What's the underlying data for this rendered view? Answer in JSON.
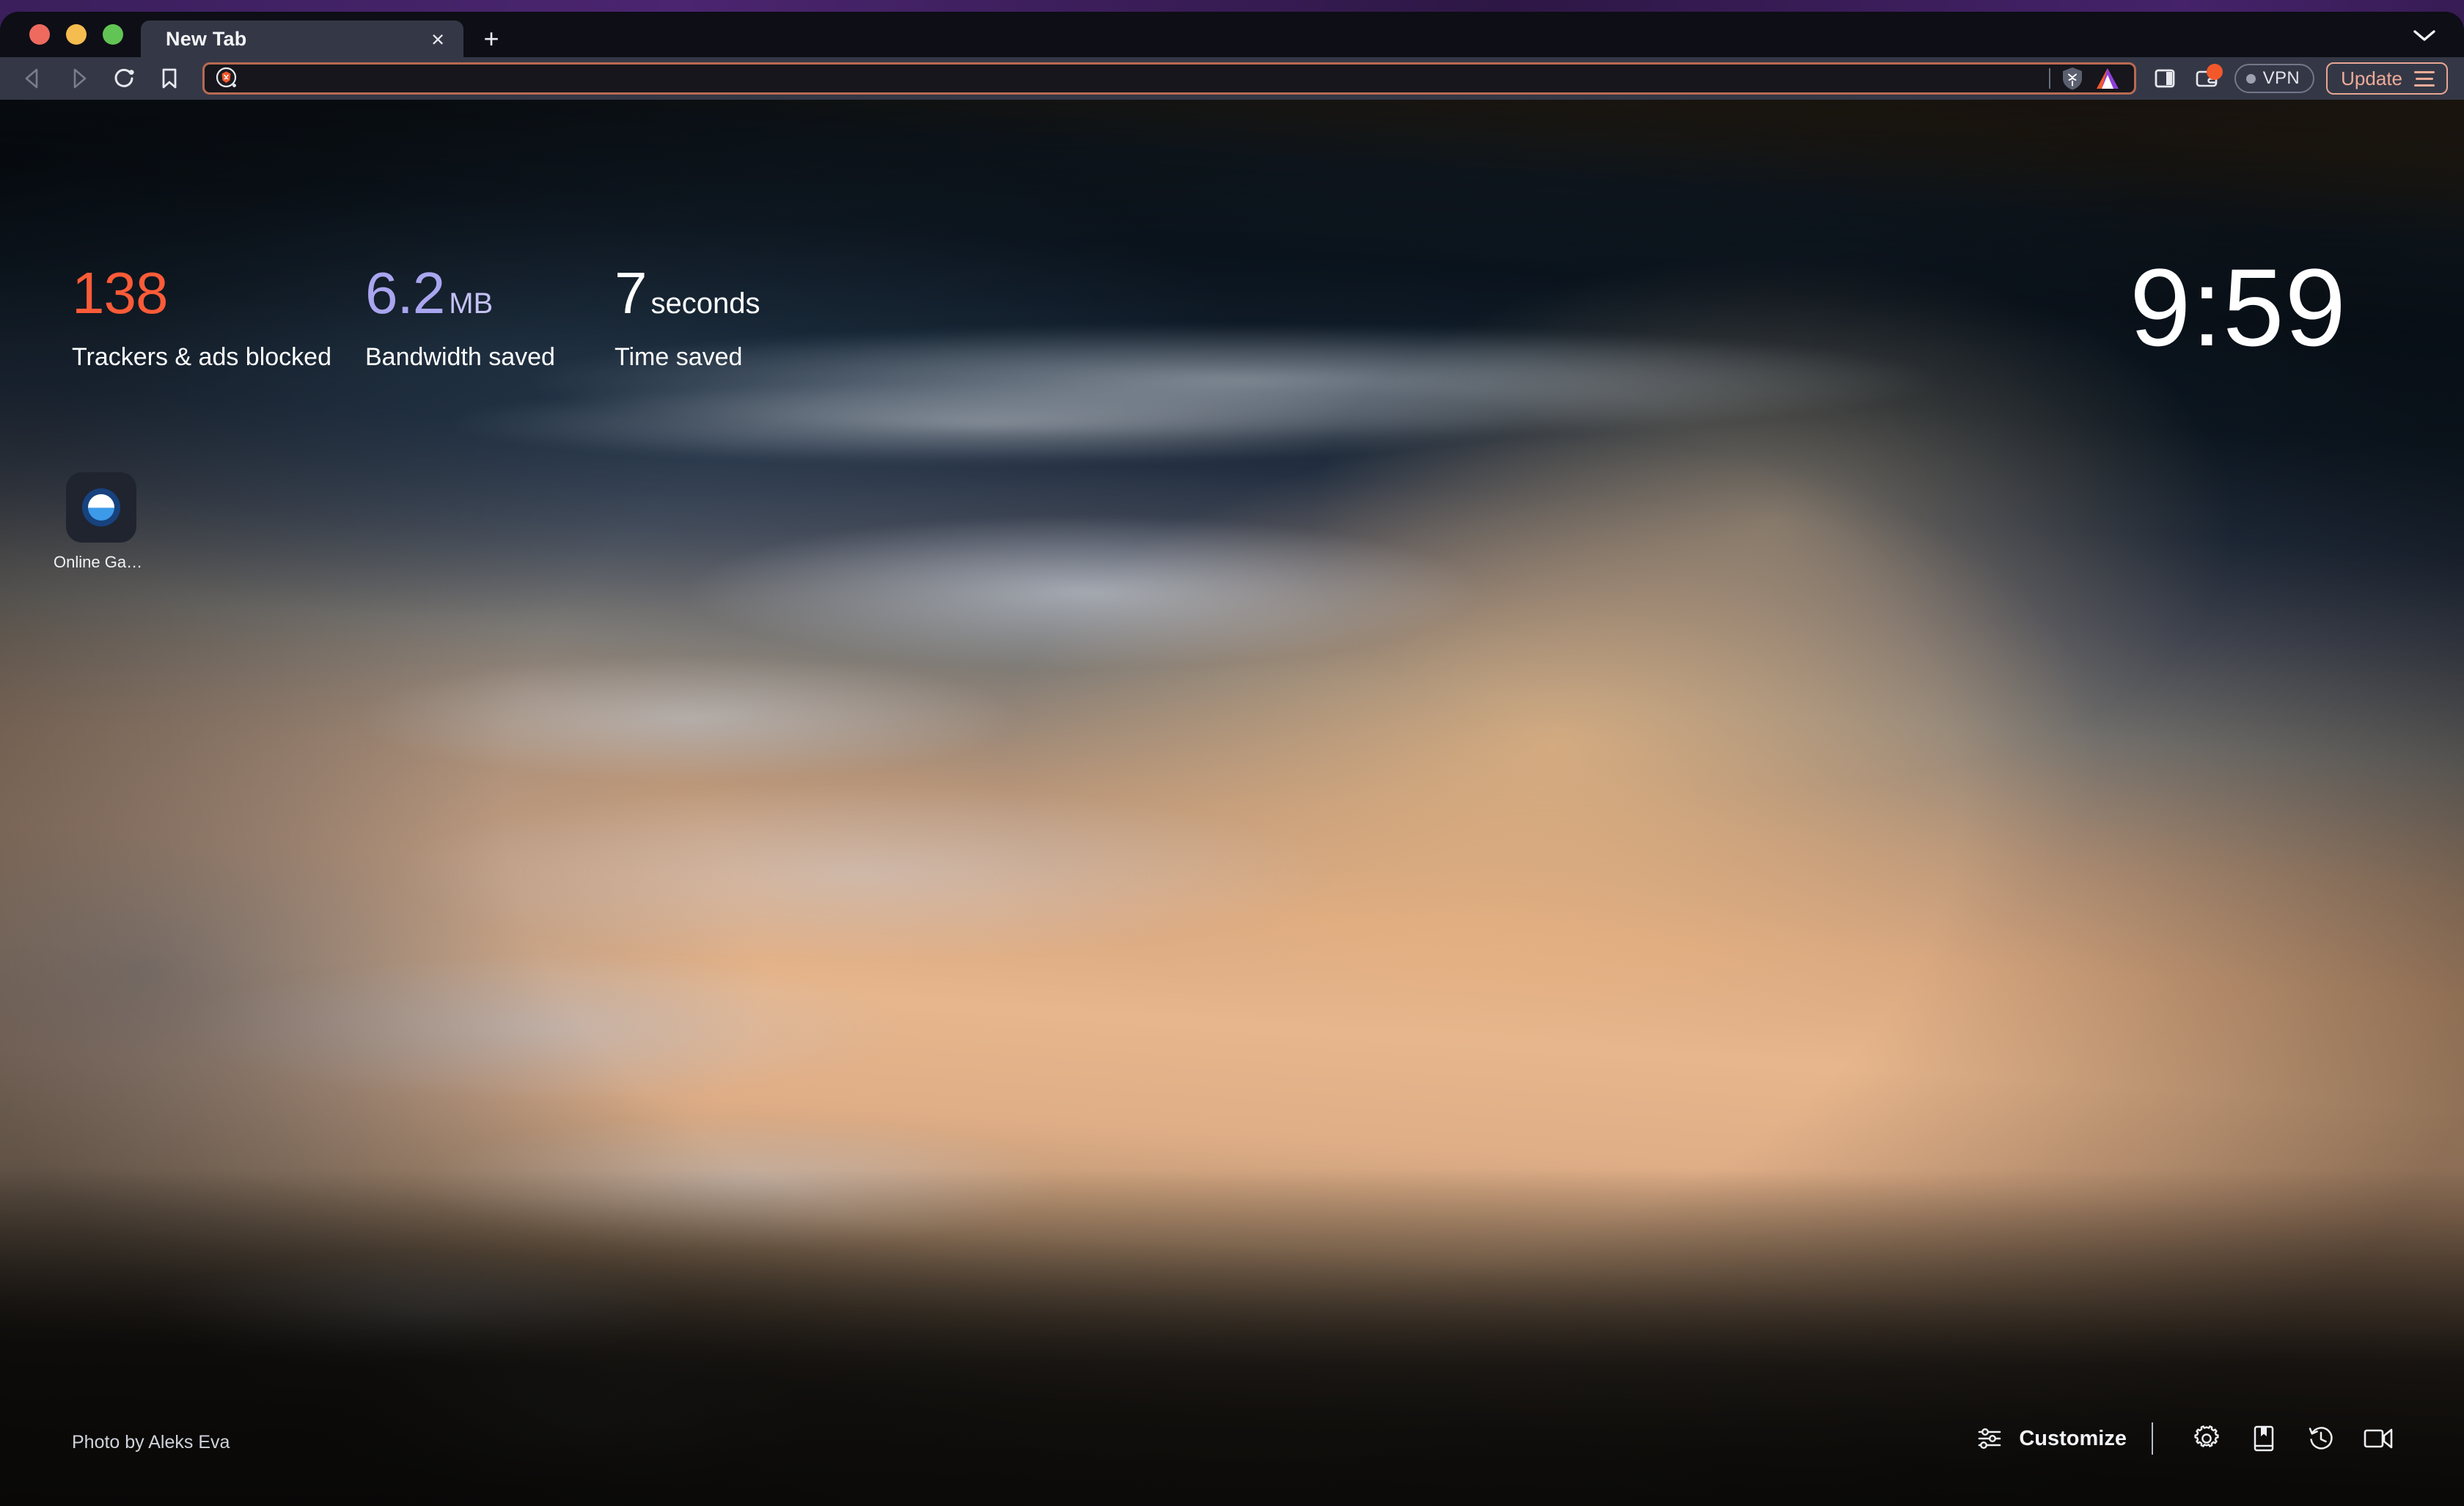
{
  "window": {
    "traffic_lights": [
      "close",
      "minimize",
      "zoom"
    ],
    "tabs": [
      {
        "title": "New Tab",
        "close_label": "×",
        "active": true
      }
    ],
    "new_tab_button_label": "+",
    "tab_search_icon": "chevron-down-icon"
  },
  "toolbar": {
    "back_icon": "back-arrow-icon",
    "forward_icon": "forward-arrow-icon",
    "reload_icon": "reload-icon",
    "bookmark_icon": "bookmark-icon",
    "address_bar": {
      "value": "",
      "placeholder": "",
      "leading_icon": "brave-search-lion-icon",
      "shields_icon": "brave-shields-lion-icon",
      "rewards_icon": "bat-triangle-icon",
      "focus_border_color": "#b86a52"
    },
    "sidebar_icon": "sidebar-panel-icon",
    "wallet_icon": "wallet-icon",
    "wallet_badge": true,
    "vpn": {
      "label": "VPN",
      "status_dot_color": "#9ca0b0"
    },
    "update": {
      "label": "Update",
      "accent_color": "#eeab98",
      "menu_icon": "hamburger-menu-icon"
    }
  },
  "new_tab_page": {
    "stats": [
      {
        "value": "138",
        "unit": "",
        "label": "Trackers & ads blocked",
        "color": "#fc5b38"
      },
      {
        "value": "6.2",
        "unit": "MB",
        "label": "Bandwidth saved",
        "color": "#a9a5ef"
      },
      {
        "value": "7",
        "unit": "seconds",
        "label": "Time saved",
        "color": "#ffffff"
      }
    ],
    "clock": "9:59",
    "top_sites": [
      {
        "label": "Online Gam...",
        "icon": "online-games-circle-icon"
      }
    ],
    "photo_credit": "Photo by Aleks Eva",
    "bottom_bar": {
      "customize_label": "Customize",
      "customize_icon": "sliders-icon",
      "icons": [
        {
          "name": "settings-gear-icon"
        },
        {
          "name": "bookmarks-book-icon"
        },
        {
          "name": "history-clock-icon"
        },
        {
          "name": "brave-talk-video-icon"
        }
      ]
    }
  }
}
